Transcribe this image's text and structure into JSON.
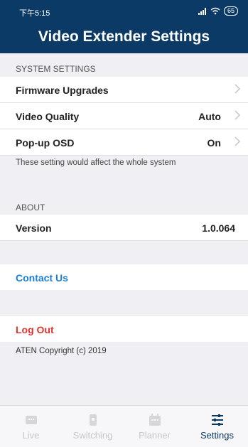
{
  "status_bar": {
    "time": "下午5:15",
    "battery": "65"
  },
  "header": {
    "title": "Video Extender Settings"
  },
  "system_settings": {
    "header": "SYSTEM SETTINGS",
    "items": [
      {
        "label": "Firmware Upgrades",
        "value": ""
      },
      {
        "label": "Video Quality",
        "value": "Auto"
      },
      {
        "label": "Pop-up OSD",
        "value": "On"
      }
    ],
    "note": "These setting would affect the whole system"
  },
  "about": {
    "header": "ABOUT",
    "version_label": "Version",
    "version_value": "1.0.064"
  },
  "contact_label": "Contact Us",
  "logout_label": "Log Out",
  "copyright": "ATEN Copyright (c)  2019",
  "tabs": [
    {
      "label": "Live",
      "icon": "live-icon",
      "active": false
    },
    {
      "label": "Switching",
      "icon": "switching-icon",
      "active": false
    },
    {
      "label": "Planner",
      "icon": "planner-icon",
      "active": false
    },
    {
      "label": "Settings",
      "icon": "settings-icon",
      "active": true
    }
  ],
  "colors": {
    "header_bg": "#0b3a66",
    "link_blue": "#1a7fd6",
    "logout_red": "#e5332a",
    "tab_inactive": "#c7c7cc"
  }
}
